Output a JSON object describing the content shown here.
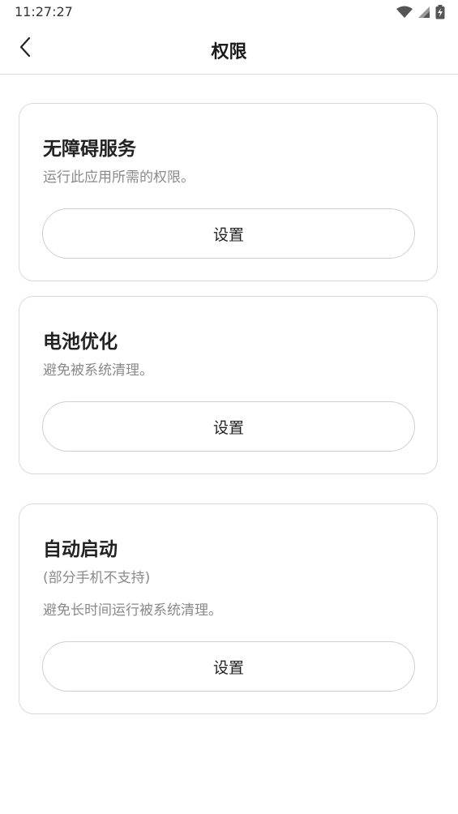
{
  "status_bar": {
    "time": "11:27:27",
    "icons": [
      "wifi-icon",
      "signal-icon",
      "battery-charging-icon"
    ]
  },
  "header": {
    "back_icon": "chevron-left-icon",
    "title": "权限"
  },
  "cards": [
    {
      "title": "无障碍服务",
      "description": "运行此应用所需的权限。",
      "button_label": "设置"
    },
    {
      "title": "电池优化",
      "description": "避免被系统清理。",
      "button_label": "设置"
    },
    {
      "title": "自动启动",
      "note": "(部分手机不支持)",
      "description": "避免长时间运行被系统清理。",
      "button_label": "设置"
    }
  ],
  "colors": {
    "background": "#ffffff",
    "card_border": "#d9d9d9",
    "description_text": "#8a8a8a",
    "title_text": "#222222"
  }
}
